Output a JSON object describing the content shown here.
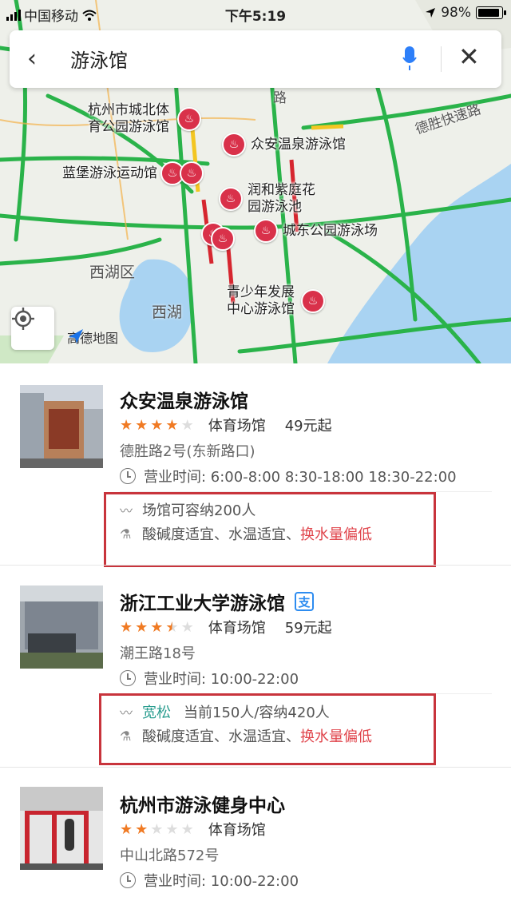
{
  "status_bar": {
    "carrier": "中国移动",
    "time": "下午5:19",
    "battery": "98%"
  },
  "search": {
    "query": "游泳馆"
  },
  "map": {
    "road_label": "德胜快速路",
    "road_label_short": "路",
    "area_labels": [
      "西湖区",
      "西湖"
    ],
    "logo": "高德地图",
    "pois": [
      "杭州市城北体\n育公园游泳馆",
      "众安温泉游泳馆",
      "蓝堡游泳运动馆",
      "润和紫庭花\n园游泳池",
      "城东公园游泳场",
      "青少年发展\n中心游泳馆"
    ]
  },
  "results": [
    {
      "name": "众安温泉游泳馆",
      "rating": 4,
      "category": "体育场馆",
      "price": "49元起",
      "address": "德胜路2号(东新路口)",
      "hours": "营业时间: 6:00-8:00 8:30-18:00 18:30-22:00",
      "capacity_text": "场馆可容纳200人",
      "water_normal": "酸碱度适宜、水温适宜、",
      "water_warn": "换水量偏低"
    },
    {
      "name": "浙江工业大学游泳馆",
      "pay_icon": "支",
      "rating": 3.5,
      "category": "体育场馆",
      "price": "59元起",
      "address": "潮王路18号",
      "hours": "营业时间: 10:00-22:00",
      "crowd_status": "宽松",
      "capacity_text": "当前150人/容纳420人",
      "water_normal": "酸碱度适宜、水温适宜、",
      "water_warn": "换水量偏低"
    },
    {
      "name": "杭州市游泳健身中心",
      "rating": 2,
      "category": "体育场馆",
      "address": "中山北路572号",
      "hours": "营业时间: 10:00-22:00"
    }
  ],
  "colors": {
    "accent_red": "#d9314a",
    "warn_text": "#e0454c",
    "loose_text": "#2a9d8f",
    "star": "#f07a23"
  }
}
